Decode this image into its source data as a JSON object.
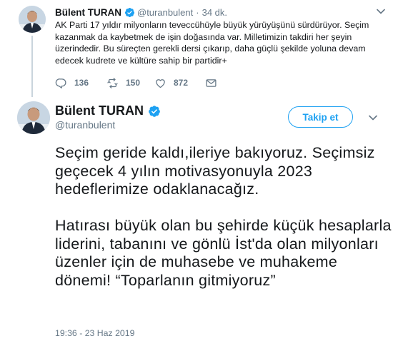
{
  "colors": {
    "accent": "#1da1f2",
    "text_primary": "#14171a",
    "text_secondary": "#657786",
    "thread_line": "#c9d4dc"
  },
  "parent_tweet": {
    "author_name": "Bülent TURAN",
    "author_handle": "@turanbulent",
    "separator": "·",
    "time_ago": "34 dk.",
    "text": "AK Parti 17 yıldır milyonların teveccühüyle büyük yürüyüşünü sürdürüyor. Seçim kazanmak da kaybetmek de işin doğasında var. Milletimizin takdiri her şeyin üzerindedir. Bu süreçten gerekli dersi çıkarıp, daha güçlü şekilde yoluna devam edecek kudrete ve kültüre sahip bir partidir+",
    "icons": {
      "avatar": "avatar-icon",
      "verified": "verified-badge-icon",
      "caret": "chevron-down-icon",
      "reply": "reply-icon",
      "retweet": "retweet-icon",
      "like": "heart-icon",
      "dm": "envelope-icon"
    },
    "actions": {
      "reply_count": "136",
      "retweet_count": "150",
      "like_count": "872"
    }
  },
  "main_tweet": {
    "author_name": "Bülent TURAN",
    "author_handle": "@turanbulent",
    "follow_label": "Takip et",
    "paragraph_1": "Seçim geride kaldı,ileriye bakıyoruz. Seçimsiz geçecek 4 yılın motivasyonuyla 2023 hedeflerimize odaklanacağız.",
    "paragraph_2": "Hatırası büyük olan bu şehirde küçük hesaplarla liderini, tabanını ve gönlü İst'da olan milyonları üzenler için de muhasebe ve muhakeme dönemi! “Toparlanın gitmiyoruz”",
    "timestamp": "19:36 - 23 Haz 2019"
  }
}
